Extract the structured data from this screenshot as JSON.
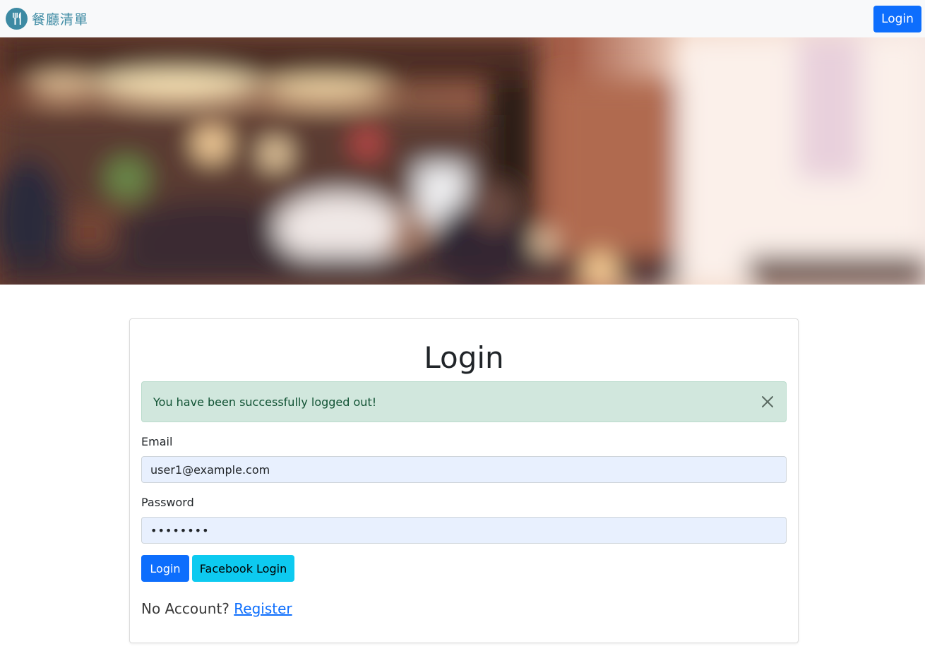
{
  "navbar": {
    "brand_icon": "fork-knife-icon",
    "brand_text": "餐廳清單",
    "login_label": "Login",
    "brand_color": "#3d8aa3"
  },
  "hero": {
    "description": "blurred restaurant interior background"
  },
  "login_card": {
    "title": "Login",
    "alert": {
      "message": "You have been successfully logged out!",
      "close_icon": "close-icon",
      "color": "#d1e7dd"
    },
    "email": {
      "label": "Email",
      "value": "user1@example.com"
    },
    "password": {
      "label": "Password",
      "value": "••••••••"
    },
    "login_button": "Login",
    "facebook_button": "Facebook Login",
    "no_account_text": "No Account?",
    "register_link": "Register"
  },
  "colors": {
    "primary": "#0d6efd",
    "info": "#0dcaf0",
    "success_bg": "#d1e7dd"
  }
}
